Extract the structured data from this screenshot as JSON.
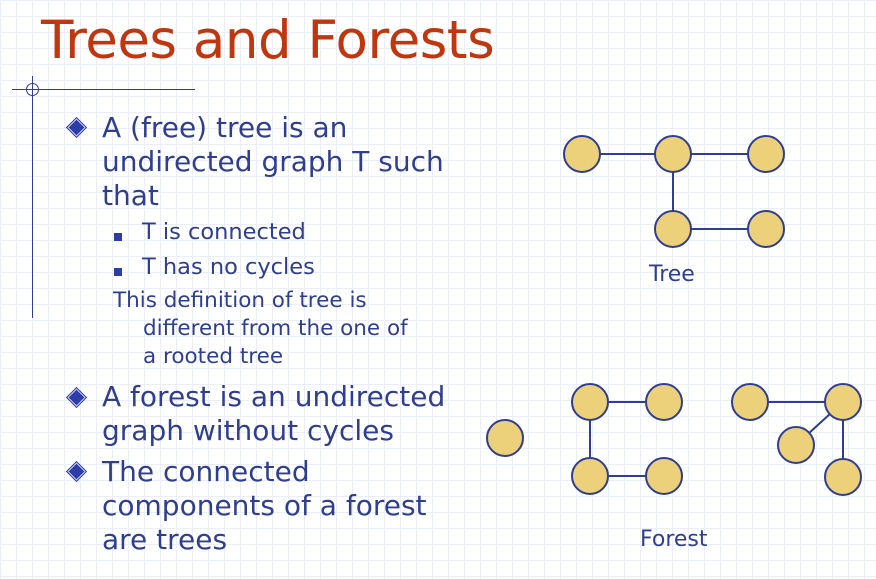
{
  "slide": {
    "title": "Trees and Forests"
  },
  "bullets": [
    {
      "lines": [
        "A (free) tree is an",
        "undirected graph T such",
        "that"
      ],
      "sub_items": [
        "T is connected",
        "T has no cycles"
      ],
      "note_lines": [
        "This definition of tree is",
        "different from the one of",
        "a rooted tree"
      ]
    },
    {
      "lines": [
        "A forest is an undirected",
        "graph without cycles"
      ]
    },
    {
      "lines": [
        "The connected",
        "components of a forest",
        "are trees"
      ]
    }
  ],
  "diagrams": {
    "tree_caption": "Tree",
    "forest_caption": "Forest"
  },
  "colors": {
    "title": "#c0360e",
    "text": "#2f3e8f",
    "bullet": "#2e3da6",
    "node_fill": "#ecd07a",
    "node_stroke": "#2f3e8f",
    "edge": "#2f3e8f"
  }
}
